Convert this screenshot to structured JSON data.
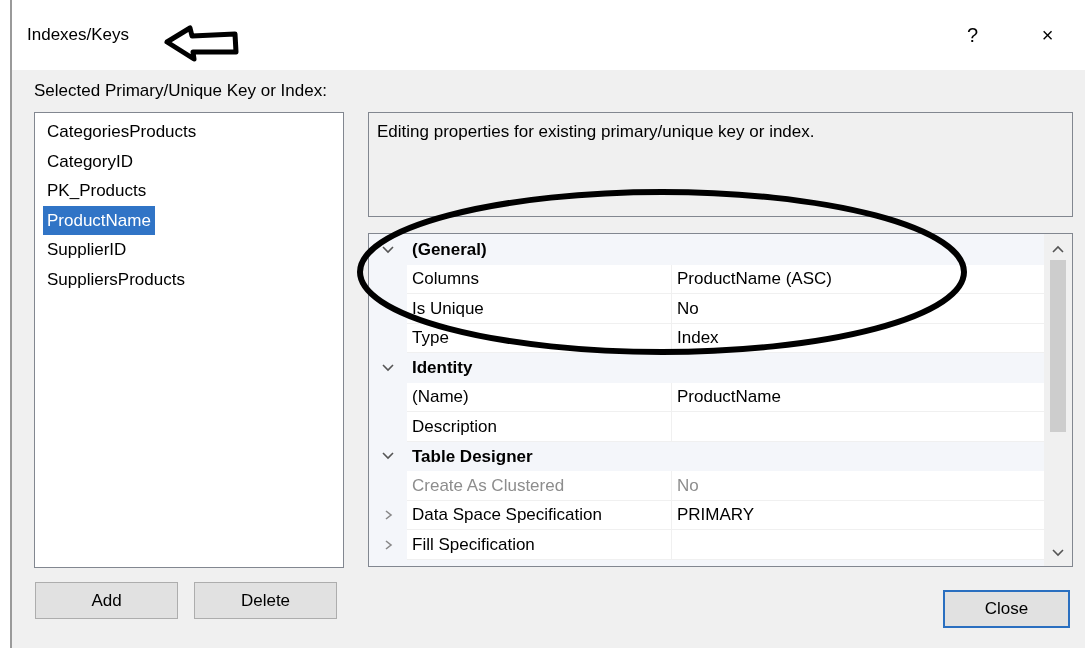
{
  "window": {
    "title": "Indexes/Keys",
    "help": "?",
    "close": "×"
  },
  "list_label": "Selected Primary/Unique Key or Index:",
  "indexes": [
    {
      "name": "CategoriesProducts",
      "selected": false
    },
    {
      "name": "CategoryID",
      "selected": false
    },
    {
      "name": "PK_Products",
      "selected": false
    },
    {
      "name": "ProductName",
      "selected": true
    },
    {
      "name": "SupplierID",
      "selected": false
    },
    {
      "name": "SuppliersProducts",
      "selected": false
    }
  ],
  "description": "Editing properties for existing primary/unique key or index.",
  "properties": [
    {
      "kind": "category",
      "name": "(General)",
      "expanded": true
    },
    {
      "kind": "property",
      "name": "Columns",
      "value": "ProductName (ASC)",
      "disabled": false
    },
    {
      "kind": "property",
      "name": "Is Unique",
      "value": "No",
      "disabled": false
    },
    {
      "kind": "property",
      "name": "Type",
      "value": "Index",
      "disabled": false
    },
    {
      "kind": "category",
      "name": "Identity",
      "expanded": true
    },
    {
      "kind": "property",
      "name": "(Name)",
      "value": "ProductName",
      "disabled": false
    },
    {
      "kind": "property",
      "name": "Description",
      "disabled": false
    },
    {
      "kind": "category",
      "name": "Table Designer",
      "expanded": true
    },
    {
      "kind": "property",
      "name": "Create As Clustered",
      "value": "No",
      "disabled": true
    },
    {
      "kind": "group",
      "name": "Data Space Specification",
      "value": "PRIMARY",
      "expanded": false
    },
    {
      "kind": "group",
      "name": "Fill Specification",
      "expanded": false
    }
  ],
  "buttons": {
    "add": "Add",
    "delete": "Delete",
    "close": "Close"
  }
}
